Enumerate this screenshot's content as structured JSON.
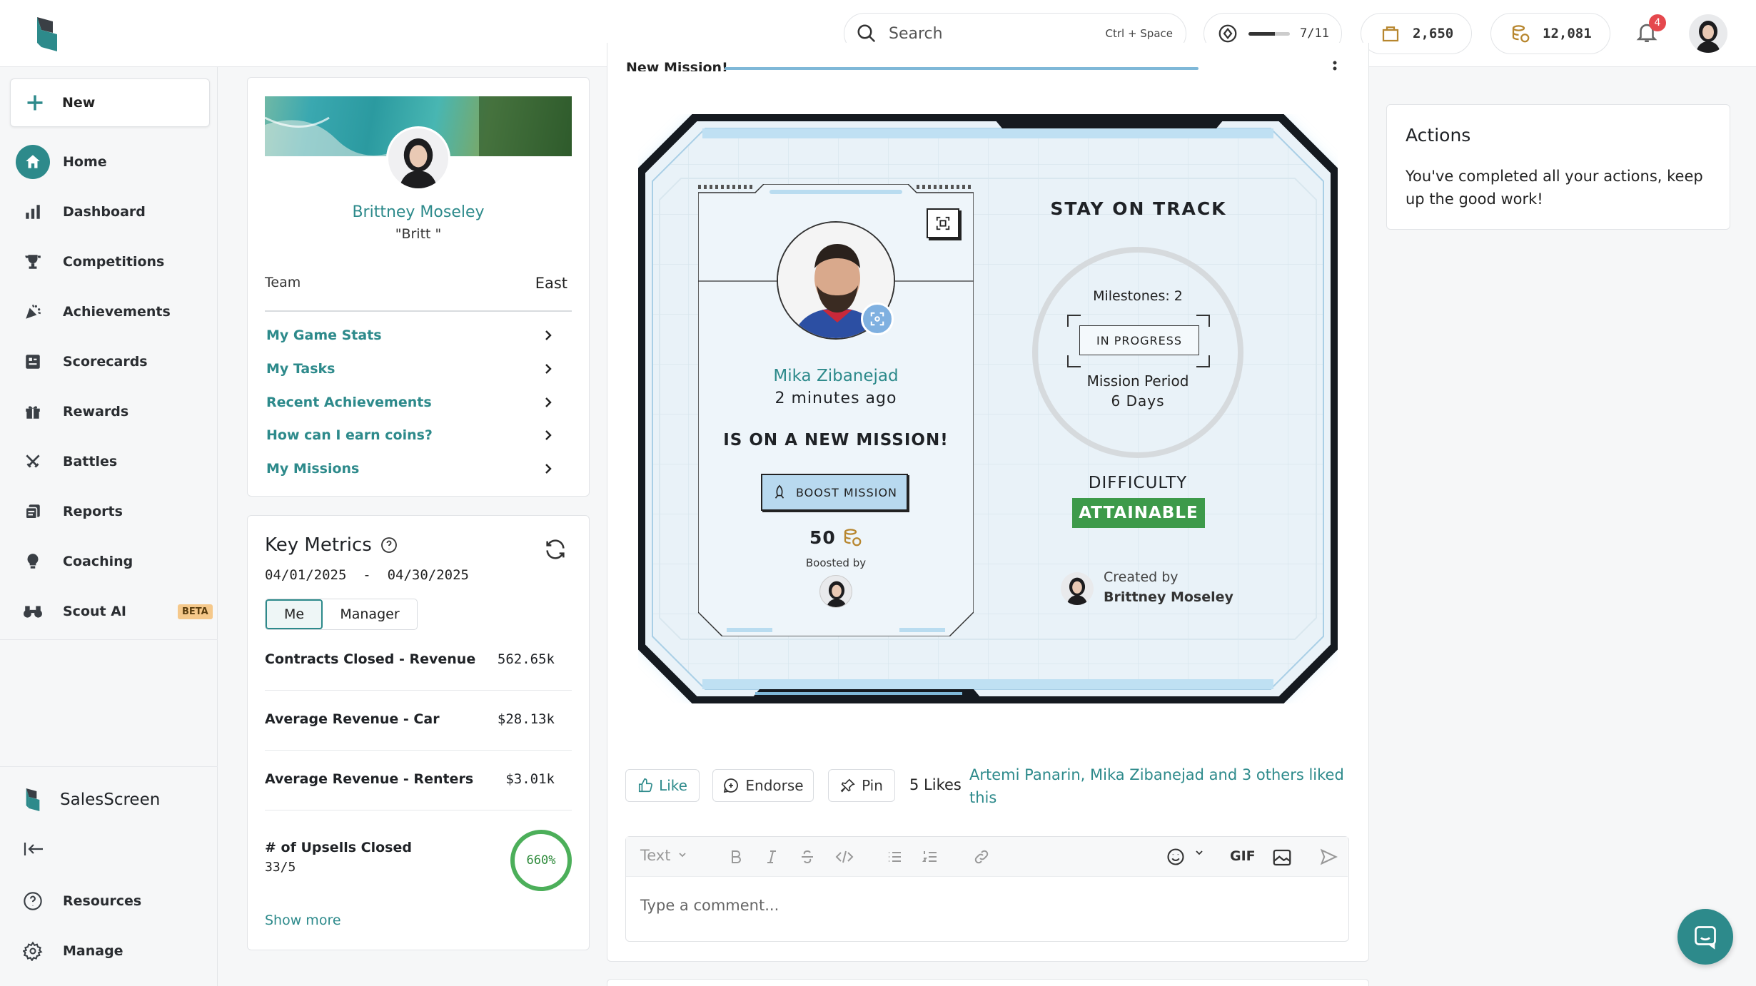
{
  "topbar": {
    "search_placeholder": "Search",
    "search_shortcut": "Ctrl + Space",
    "level_progress": "7/11",
    "level_fraction": 0.64,
    "bag_coins": "2,650",
    "wallet_coins": "12,081",
    "notification_count": "4"
  },
  "sidebar": {
    "new_label": "New",
    "items": [
      {
        "label": "Home",
        "icon": "home-icon"
      },
      {
        "label": "Dashboard",
        "icon": "bar-chart-icon"
      },
      {
        "label": "Competitions",
        "icon": "trophy-icon"
      },
      {
        "label": "Achievements",
        "icon": "confetti-icon"
      },
      {
        "label": "Scorecards",
        "icon": "scorecard-icon"
      },
      {
        "label": "Rewards",
        "icon": "gift-icon"
      },
      {
        "label": "Battles",
        "icon": "crossed-swords-icon"
      },
      {
        "label": "Reports",
        "icon": "reports-icon"
      },
      {
        "label": "Coaching",
        "icon": "lightbulb-icon"
      },
      {
        "label": "Scout AI",
        "icon": "binoculars-icon",
        "badge": "BETA"
      }
    ],
    "brand": "SalesScreen",
    "bottom": [
      {
        "label": "Resources",
        "icon": "question-circle-icon"
      },
      {
        "label": "Manage",
        "icon": "gear-icon"
      }
    ]
  },
  "profile": {
    "name": "Brittney Moseley",
    "nickname": "\"Britt \"",
    "team_label": "Team",
    "team_value": "East",
    "links": [
      "My Game Stats",
      "My Tasks",
      "Recent Achievements",
      "How can I earn coins?",
      "My Missions"
    ]
  },
  "metrics": {
    "title": "Key Metrics",
    "date_range": "04/01/2025  -  04/30/2025",
    "toggle": [
      "Me",
      "Manager"
    ],
    "rows": [
      {
        "label": "Contracts Closed - Revenue",
        "value": "562.65k"
      },
      {
        "label": "Average Revenue - Car",
        "value": "$28.13k"
      },
      {
        "label": "Average Revenue - Renters",
        "value": "$3.01k"
      }
    ],
    "upsell_label": "# of Upsells Closed",
    "upsell_sub": "33/5",
    "upsell_percent": "660%",
    "show_more": "Show more"
  },
  "mission": {
    "header_label": "New Mission!",
    "player_name": "Mika Zibanejad",
    "time_ago": "2 minutes ago",
    "headline": "IS ON A NEW MISSION!",
    "boost_label": "BOOST MISSION",
    "boost_amount": "50",
    "boosted_by": "Boosted by",
    "stay_on_track": "STAY ON TRACK",
    "milestones": "Milestones: 2",
    "status": "IN PROGRESS",
    "period_label": "Mission Period",
    "period_value": "6 Days",
    "difficulty_label": "DIFFICULTY",
    "difficulty_value": "ATTAINABLE",
    "created_by_label": "Created by",
    "created_by_name": "Brittney Moseley"
  },
  "social": {
    "like": "Like",
    "endorse": "Endorse",
    "pin": "Pin",
    "likes_count": "5 Likes",
    "likers": "Artemi Panarin, Mika Zibanejad and 3 others liked this"
  },
  "comment": {
    "format": "Text",
    "gif": "GIF",
    "placeholder": "Type a comment..."
  },
  "actions": {
    "title": "Actions",
    "message": "You've completed all your actions, keep up the good work!"
  },
  "colors": {
    "teal": "#2d8a8b",
    "green": "#3d9a4a",
    "notification_red": "#e5484d"
  }
}
